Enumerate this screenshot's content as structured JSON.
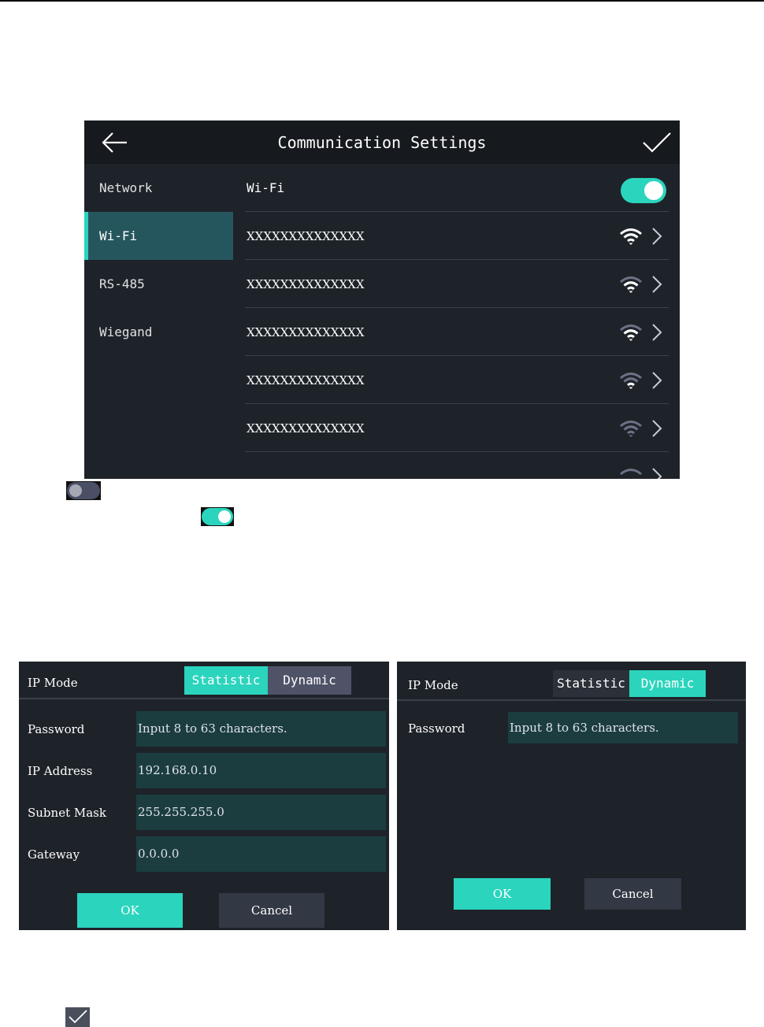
{
  "screen1": {
    "title": "Communication Settings",
    "sidebar": [
      "Network",
      "Wi-Fi",
      "RS-485",
      "Wiegand"
    ],
    "active_sidebar": "Wi-Fi",
    "wifi_label": "Wi-Fi",
    "wifi_enabled": true,
    "networks": [
      "XXXXXXXXXXXXXX",
      "XXXXXXXXXXXXXX",
      "XXXXXXXXXXXXXX",
      "XXXXXXXXXXXXXX",
      "XXXXXXXXXXXXXX"
    ]
  },
  "inline_toggles": {
    "off": false,
    "on": true
  },
  "screen2": {
    "ip_mode_label": "IP Mode",
    "mode_options": [
      "Statistic",
      "Dynamic"
    ],
    "selected_mode": "Statistic",
    "fields": [
      {
        "label": "Password",
        "value": "Input 8 to 63 characters."
      },
      {
        "label": "IP Address",
        "value": "192.168.0.10"
      },
      {
        "label": "Subnet Mask",
        "value": "255.255.255.0"
      },
      {
        "label": "Gateway",
        "value": "0.0.0.0"
      }
    ],
    "ok_label": "OK",
    "cancel_label": "Cancel"
  },
  "screen3": {
    "ip_mode_label": "IP Mode",
    "mode_options": [
      "Statistic",
      "Dynamic"
    ],
    "selected_mode": "Dynamic",
    "fields": [
      {
        "label": "Password",
        "value": "Input 8 to 63 characters."
      }
    ],
    "ok_label": "OK",
    "cancel_label": "Cancel"
  },
  "colors": {
    "accent": "#2bd4bd",
    "panel_bg": "#1e2329",
    "header_bg": "#16191d",
    "field_bg": "#1b3d40",
    "segment_off": "#4f5368"
  },
  "icons": [
    "back-arrow-icon",
    "check-icon",
    "wifi-icon",
    "chevron-right-icon"
  ]
}
